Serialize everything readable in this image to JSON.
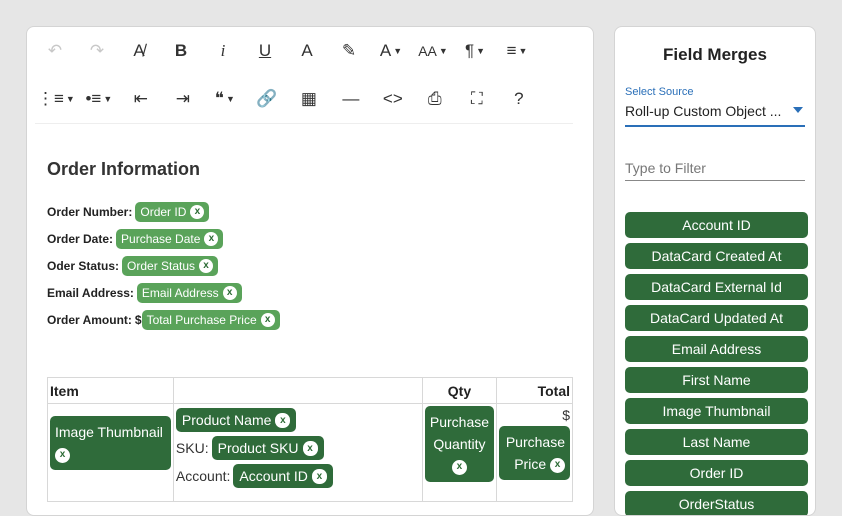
{
  "toolbar": {
    "row1": [
      {
        "icon": "undo-icon",
        "glyph": "↶",
        "disabled": true
      },
      {
        "icon": "redo-icon",
        "glyph": "↷",
        "disabled": true
      },
      {
        "icon": "clear-formatting-icon",
        "glyph": "A̸"
      },
      {
        "icon": "bold-icon",
        "glyph": "B"
      },
      {
        "icon": "italic-icon",
        "glyph": "i"
      },
      {
        "icon": "underline-icon",
        "glyph": "U"
      },
      {
        "icon": "text-color-icon",
        "glyph": "A"
      },
      {
        "icon": "highlighter-icon",
        "glyph": "✎"
      },
      {
        "icon": "font-family-icon",
        "glyph": "A",
        "caret": true
      },
      {
        "icon": "font-size-icon",
        "glyph": "AA",
        "caret": true
      },
      {
        "icon": "paragraph-format-icon",
        "glyph": "¶",
        "caret": true
      },
      {
        "icon": "align-icon",
        "glyph": "≡",
        "caret": true
      }
    ],
    "row2": [
      {
        "icon": "ordered-list-icon",
        "glyph": "⋮≡",
        "caret": true
      },
      {
        "icon": "unordered-list-icon",
        "glyph": "•≡",
        "caret": true
      },
      {
        "icon": "outdent-icon",
        "glyph": "⇤"
      },
      {
        "icon": "indent-icon",
        "glyph": "⇥"
      },
      {
        "icon": "quote-icon",
        "glyph": "❝",
        "caret": true
      },
      {
        "icon": "link-icon",
        "glyph": "🔗"
      },
      {
        "icon": "table-icon",
        "glyph": "▦"
      },
      {
        "icon": "horizontal-line-icon",
        "glyph": "—"
      },
      {
        "icon": "code-view-icon",
        "glyph": "<>"
      },
      {
        "icon": "pdf-icon",
        "glyph": "⎙"
      },
      {
        "icon": "fullscreen-icon",
        "glyph": "⛶"
      },
      {
        "icon": "help-icon",
        "glyph": "?"
      }
    ]
  },
  "document": {
    "title": "Order Information",
    "fields": [
      {
        "label": "Order Number:",
        "chip": "Order ID"
      },
      {
        "label": "Order Date:",
        "chip": "Purchase Date"
      },
      {
        "label": "Oder Status:",
        "chip": "Order Status"
      },
      {
        "label": "Email Address:",
        "chip": "Email Address"
      },
      {
        "label": "Order Amount:",
        "prefix": "$",
        "chip": "Total Purchase Price"
      }
    ],
    "table": {
      "headers": [
        "Item",
        "",
        "Qty",
        "Total"
      ],
      "image_chip": "Image Thumbnail",
      "product_chip": "Product Name",
      "sku_label": "SKU:",
      "sku_chip": "Product SKU",
      "account_label": "Account:",
      "account_chip": "Account ID",
      "qty_chip": "Purchase Quantity",
      "total_prefix": "$",
      "total_chip": "Purchase Price"
    },
    "remove_glyph": "x"
  },
  "panel": {
    "title": "Field Merges",
    "source_label": "Select Source",
    "source_value": "Roll-up Custom Object ...",
    "filter_placeholder": "Type to Filter",
    "merge_fields": [
      "Account ID",
      "DataCard Created At",
      "DataCard External Id",
      "DataCard Updated At",
      "Email Address",
      "First Name",
      "Image Thumbnail",
      "Last Name",
      "Order ID",
      "OrderStatus"
    ]
  },
  "colors": {
    "chip_light": "#5aa35a",
    "chip_dark": "#2f6b3a",
    "accent_blue": "#2a6fb8"
  }
}
